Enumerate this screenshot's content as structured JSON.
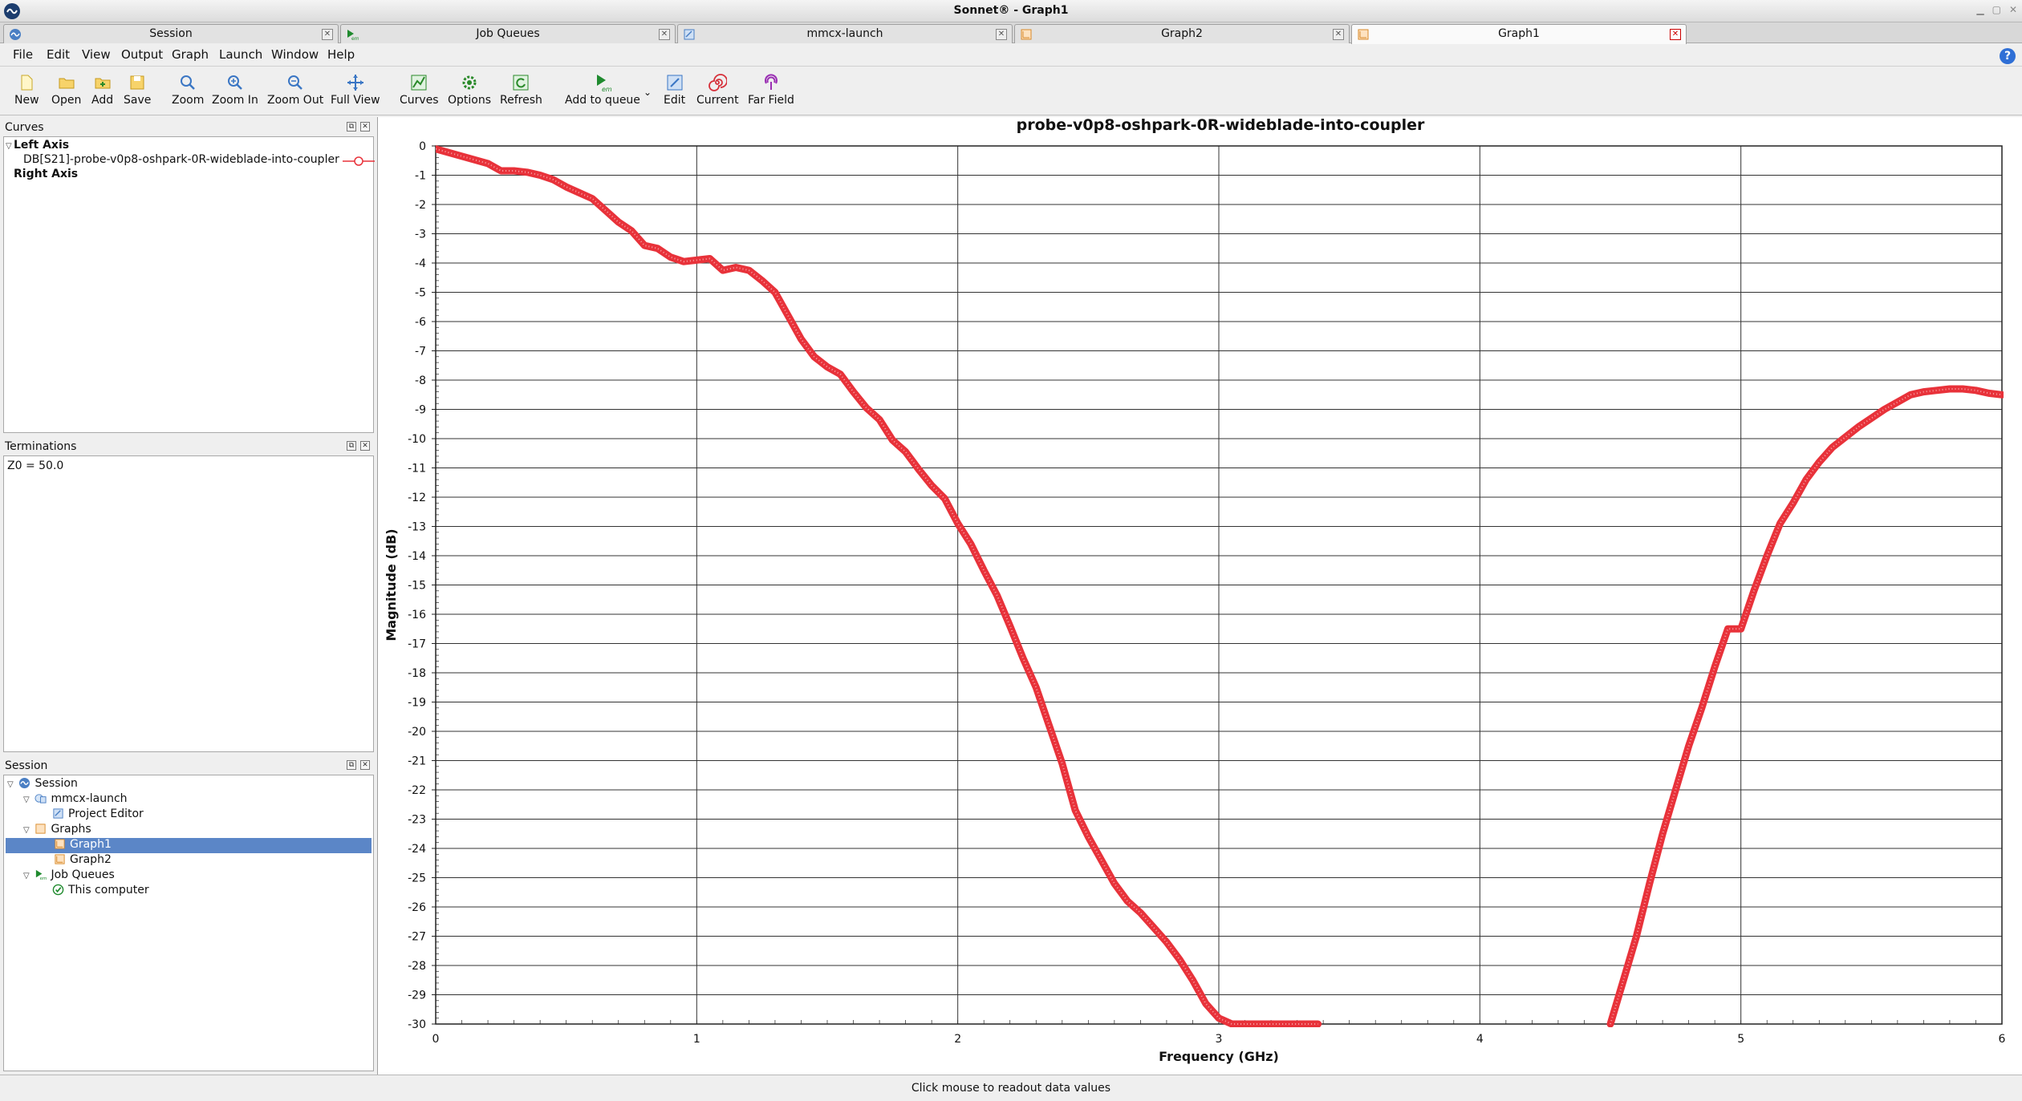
{
  "window": {
    "title": "Sonnet® - Graph1"
  },
  "tabs": [
    {
      "label": "Session",
      "icon": "session-icon"
    },
    {
      "label": "Job Queues",
      "icon": "job-queue-icon"
    },
    {
      "label": "mmcx-launch",
      "icon": "project-icon"
    },
    {
      "label": "Graph2",
      "icon": "graph-icon"
    },
    {
      "label": "Graph1",
      "icon": "graph-icon",
      "active": true
    }
  ],
  "menu": [
    "File",
    "Edit",
    "View",
    "Output",
    "Graph",
    "Launch",
    "Window",
    "Help"
  ],
  "toolbar": {
    "new": "New",
    "open": "Open",
    "add": "Add",
    "save": "Save",
    "zoom": "Zoom",
    "zoom_in": "Zoom In",
    "zoom_out": "Zoom Out",
    "full_view": "Full View",
    "curves": "Curves",
    "options": "Options",
    "refresh": "Refresh",
    "add_to_queue": "Add to queue",
    "edit": "Edit",
    "current": "Current",
    "far_field": "Far Field"
  },
  "curves_panel": {
    "title": "Curves",
    "left_axis": "Left Axis",
    "curve": "DB[S21]-probe-v0p8-oshpark-0R-wideblade-into-coupler",
    "right_axis": "Right Axis"
  },
  "terminations_panel": {
    "title": "Terminations",
    "value": "Z0 = 50.0"
  },
  "session_panel": {
    "title": "Session",
    "items": {
      "session": "Session",
      "project": "mmcx-launch",
      "project_editor": "Project Editor",
      "graphs": "Graphs",
      "graph1": "Graph1",
      "graph2": "Graph2",
      "job_queues": "Job Queues",
      "this_computer": "This computer"
    }
  },
  "status": "Click mouse to readout data values",
  "colors": {
    "curve": "#e8323a",
    "selection": "#5b86c7"
  },
  "chart_data": {
    "type": "line",
    "title": "probe-v0p8-oshpark-0R-wideblade-into-coupler",
    "xlabel": "Frequency (GHz)",
    "ylabel": "Magnitude (dB)",
    "xlim": [
      0,
      6
    ],
    "ylim": [
      -30,
      0
    ],
    "x_ticks": [
      0,
      1,
      2,
      3,
      4,
      5,
      6
    ],
    "y_ticks": [
      0,
      -1,
      -2,
      -3,
      -4,
      -5,
      -6,
      -7,
      -8,
      -9,
      -10,
      -11,
      -12,
      -13,
      -14,
      -15,
      -16,
      -17,
      -18,
      -19,
      -20,
      -21,
      -22,
      -23,
      -24,
      -25,
      -26,
      -27,
      -28,
      -29,
      -30
    ],
    "grid": true,
    "series": [
      {
        "name": "DB[S21]-probe-v0p8-oshpark-0R-wideblade-into-coupler",
        "segments": [
          {
            "x": [
              0.0,
              0.1,
              0.2,
              0.25,
              0.3,
              0.35,
              0.4,
              0.45,
              0.5,
              0.55,
              0.6,
              0.65,
              0.7,
              0.75,
              0.8,
              0.85,
              0.9,
              0.95,
              1.0,
              1.05,
              1.1,
              1.15,
              1.2,
              1.25,
              1.3,
              1.35,
              1.4,
              1.45,
              1.5,
              1.55,
              1.6,
              1.65,
              1.7,
              1.75,
              1.8,
              1.85,
              1.9,
              1.95,
              2.0,
              2.05,
              2.1,
              2.15,
              2.2,
              2.25,
              2.3,
              2.35,
              2.4,
              2.45,
              2.5,
              2.55,
              2.6,
              2.65,
              2.7,
              2.75,
              2.8,
              2.85,
              2.9,
              2.95,
              3.0,
              3.05,
              3.1,
              3.15,
              3.2,
              3.25,
              3.3,
              3.35,
              3.38
            ],
            "y": [
              -0.1,
              -0.35,
              -0.6,
              -0.85,
              -0.85,
              -0.9,
              -1.0,
              -1.15,
              -1.4,
              -1.6,
              -1.8,
              -2.2,
              -2.6,
              -2.9,
              -3.4,
              -3.5,
              -3.8,
              -3.95,
              -3.9,
              -3.85,
              -4.25,
              -4.15,
              -4.25,
              -4.6,
              -5.0,
              -5.8,
              -6.6,
              -7.2,
              -7.55,
              -7.8,
              -8.4,
              -8.95,
              -9.35,
              -10.05,
              -10.45,
              -11.05,
              -11.6,
              -12.05,
              -12.9,
              -13.6,
              -14.5,
              -15.35,
              -16.4,
              -17.5,
              -18.5,
              -19.8,
              -21.1,
              -22.7,
              -23.6,
              -24.4,
              -25.2,
              -25.8,
              -26.2,
              -26.7,
              -27.2,
              -27.8,
              -28.5,
              -29.3,
              -29.8,
              -30.0,
              -30.0,
              -30.0,
              -30.0,
              -30.0,
              -30.0,
              -30.0,
              -30.0
            ]
          },
          {
            "x": [
              4.5,
              4.55,
              4.6,
              4.65,
              4.7,
              4.75,
              4.8,
              4.85,
              4.9,
              4.95,
              5.0,
              5.05,
              5.1,
              5.15,
              5.2,
              5.25,
              5.3,
              5.35,
              5.4,
              5.45,
              5.5,
              5.55,
              5.6,
              5.65,
              5.7,
              5.75,
              5.8,
              5.85,
              5.9,
              5.95,
              6.0
            ],
            "y": [
              -30.0,
              -28.5,
              -27.0,
              -25.2,
              -23.5,
              -22.0,
              -20.5,
              -19.2,
              -17.8,
              -16.5,
              -16.5,
              -15.2,
              -14.0,
              -12.9,
              -12.2,
              -11.4,
              -10.8,
              -10.3,
              -9.95,
              -9.6,
              -9.3,
              -9.0,
              -8.75,
              -8.5,
              -8.4,
              -8.35,
              -8.3,
              -8.3,
              -8.35,
              -8.45,
              -8.5
            ]
          }
        ]
      }
    ]
  }
}
